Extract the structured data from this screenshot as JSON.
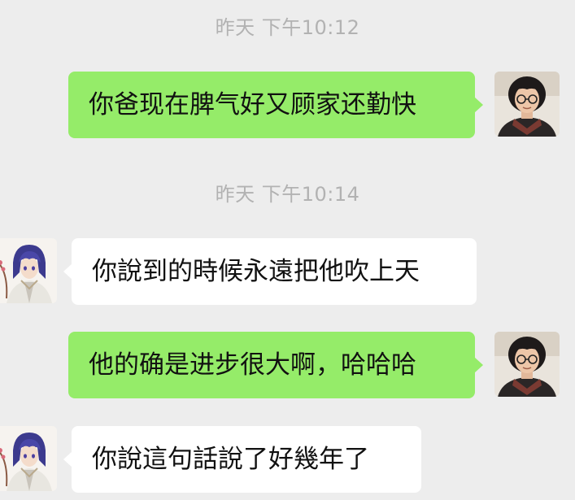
{
  "chat": {
    "time_1": "昨天 下午10:12",
    "time_2": "昨天 下午10:14",
    "messages": [
      {
        "sender": "me",
        "text": "你爸现在脾气好又顾家还勤快"
      },
      {
        "sender": "other",
        "text": "你說到的時候永遠把他吹上天"
      },
      {
        "sender": "me",
        "text": "他的确是进步很大啊，哈哈哈"
      },
      {
        "sender": "other",
        "text": "你說這句話說了好幾年了"
      }
    ]
  },
  "colors": {
    "background": "#ededed",
    "my_bubble": "#95ec69",
    "other_bubble": "#ffffff",
    "timestamp_text": "#b2b2b2"
  },
  "icons": {
    "my_avatar": "avatar-man-glasses-icon",
    "other_avatar": "avatar-anime-character-icon"
  }
}
